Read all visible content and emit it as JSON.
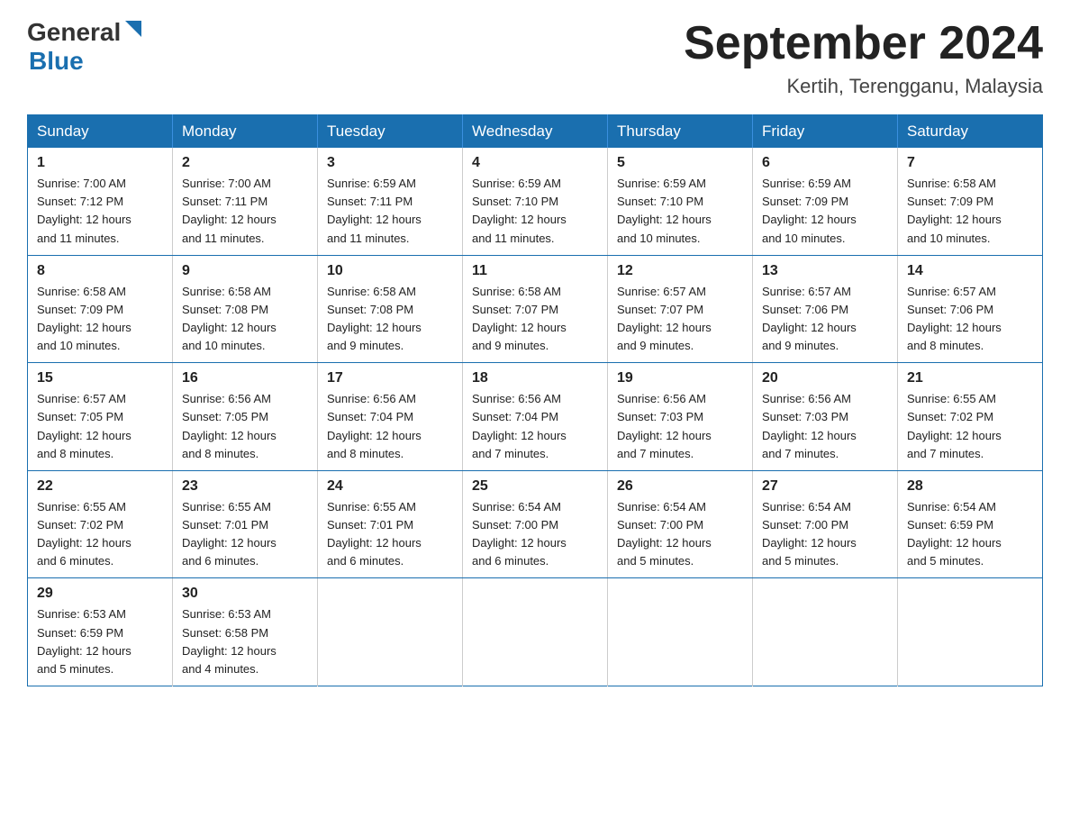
{
  "logo": {
    "text1": "General",
    "text2": "Blue"
  },
  "title": "September 2024",
  "subtitle": "Kertih, Terengganu, Malaysia",
  "headers": [
    "Sunday",
    "Monday",
    "Tuesday",
    "Wednesday",
    "Thursday",
    "Friday",
    "Saturday"
  ],
  "weeks": [
    [
      {
        "day": "1",
        "sunrise": "7:00 AM",
        "sunset": "7:12 PM",
        "daylight": "12 hours and 11 minutes."
      },
      {
        "day": "2",
        "sunrise": "7:00 AM",
        "sunset": "7:11 PM",
        "daylight": "12 hours and 11 minutes."
      },
      {
        "day": "3",
        "sunrise": "6:59 AM",
        "sunset": "7:11 PM",
        "daylight": "12 hours and 11 minutes."
      },
      {
        "day": "4",
        "sunrise": "6:59 AM",
        "sunset": "7:10 PM",
        "daylight": "12 hours and 11 minutes."
      },
      {
        "day": "5",
        "sunrise": "6:59 AM",
        "sunset": "7:10 PM",
        "daylight": "12 hours and 10 minutes."
      },
      {
        "day": "6",
        "sunrise": "6:59 AM",
        "sunset": "7:09 PM",
        "daylight": "12 hours and 10 minutes."
      },
      {
        "day": "7",
        "sunrise": "6:58 AM",
        "sunset": "7:09 PM",
        "daylight": "12 hours and 10 minutes."
      }
    ],
    [
      {
        "day": "8",
        "sunrise": "6:58 AM",
        "sunset": "7:09 PM",
        "daylight": "12 hours and 10 minutes."
      },
      {
        "day": "9",
        "sunrise": "6:58 AM",
        "sunset": "7:08 PM",
        "daylight": "12 hours and 10 minutes."
      },
      {
        "day": "10",
        "sunrise": "6:58 AM",
        "sunset": "7:08 PM",
        "daylight": "12 hours and 9 minutes."
      },
      {
        "day": "11",
        "sunrise": "6:58 AM",
        "sunset": "7:07 PM",
        "daylight": "12 hours and 9 minutes."
      },
      {
        "day": "12",
        "sunrise": "6:57 AM",
        "sunset": "7:07 PM",
        "daylight": "12 hours and 9 minutes."
      },
      {
        "day": "13",
        "sunrise": "6:57 AM",
        "sunset": "7:06 PM",
        "daylight": "12 hours and 9 minutes."
      },
      {
        "day": "14",
        "sunrise": "6:57 AM",
        "sunset": "7:06 PM",
        "daylight": "12 hours and 8 minutes."
      }
    ],
    [
      {
        "day": "15",
        "sunrise": "6:57 AM",
        "sunset": "7:05 PM",
        "daylight": "12 hours and 8 minutes."
      },
      {
        "day": "16",
        "sunrise": "6:56 AM",
        "sunset": "7:05 PM",
        "daylight": "12 hours and 8 minutes."
      },
      {
        "day": "17",
        "sunrise": "6:56 AM",
        "sunset": "7:04 PM",
        "daylight": "12 hours and 8 minutes."
      },
      {
        "day": "18",
        "sunrise": "6:56 AM",
        "sunset": "7:04 PM",
        "daylight": "12 hours and 7 minutes."
      },
      {
        "day": "19",
        "sunrise": "6:56 AM",
        "sunset": "7:03 PM",
        "daylight": "12 hours and 7 minutes."
      },
      {
        "day": "20",
        "sunrise": "6:56 AM",
        "sunset": "7:03 PM",
        "daylight": "12 hours and 7 minutes."
      },
      {
        "day": "21",
        "sunrise": "6:55 AM",
        "sunset": "7:02 PM",
        "daylight": "12 hours and 7 minutes."
      }
    ],
    [
      {
        "day": "22",
        "sunrise": "6:55 AM",
        "sunset": "7:02 PM",
        "daylight": "12 hours and 6 minutes."
      },
      {
        "day": "23",
        "sunrise": "6:55 AM",
        "sunset": "7:01 PM",
        "daylight": "12 hours and 6 minutes."
      },
      {
        "day": "24",
        "sunrise": "6:55 AM",
        "sunset": "7:01 PM",
        "daylight": "12 hours and 6 minutes."
      },
      {
        "day": "25",
        "sunrise": "6:54 AM",
        "sunset": "7:00 PM",
        "daylight": "12 hours and 6 minutes."
      },
      {
        "day": "26",
        "sunrise": "6:54 AM",
        "sunset": "7:00 PM",
        "daylight": "12 hours and 5 minutes."
      },
      {
        "day": "27",
        "sunrise": "6:54 AM",
        "sunset": "7:00 PM",
        "daylight": "12 hours and 5 minutes."
      },
      {
        "day": "28",
        "sunrise": "6:54 AM",
        "sunset": "6:59 PM",
        "daylight": "12 hours and 5 minutes."
      }
    ],
    [
      {
        "day": "29",
        "sunrise": "6:53 AM",
        "sunset": "6:59 PM",
        "daylight": "12 hours and 5 minutes."
      },
      {
        "day": "30",
        "sunrise": "6:53 AM",
        "sunset": "6:58 PM",
        "daylight": "12 hours and 4 minutes."
      },
      null,
      null,
      null,
      null,
      null
    ]
  ]
}
